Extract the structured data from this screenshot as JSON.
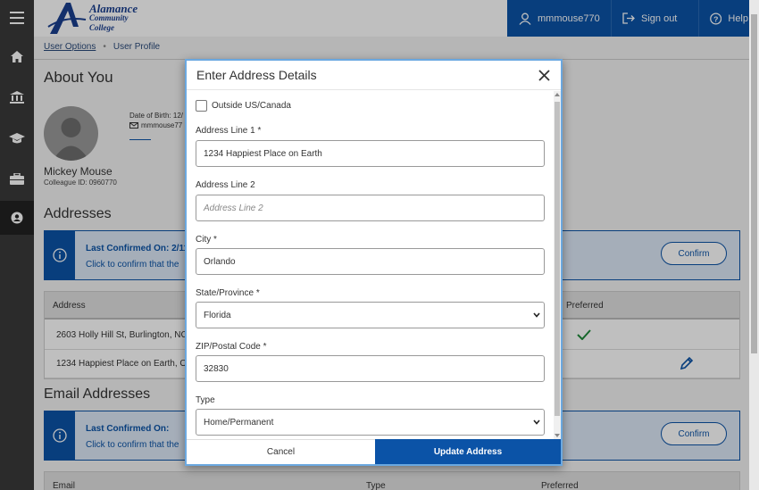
{
  "header": {
    "logo": {
      "line1": "Alamance",
      "line2": "Community College"
    },
    "user_label": "mmmouse770",
    "signout_label": "Sign out",
    "help_label": "Help"
  },
  "breadcrumb": {
    "link": "User Options",
    "current": "User Profile"
  },
  "profile": {
    "heading": "About You",
    "dob_text": "Date of Birth: 12/",
    "email_text": "mmmouse77",
    "name": "Mickey Mouse",
    "colleague_id": "Colleague ID: 0960770"
  },
  "addresses": {
    "heading": "Addresses",
    "confirm_title": "Last Confirmed On: 2/11",
    "confirm_text": "Click to confirm that the",
    "confirm_button": "Confirm",
    "columns": {
      "address": "Address",
      "preferred": "Preferred"
    },
    "rows": [
      {
        "address": "2603 Holly Hill St, Burlington, NC ..."
      },
      {
        "address": "1234 Happiest Place on Earth, Orl"
      }
    ]
  },
  "email_addresses": {
    "heading": "Email Addresses",
    "confirm_title": "Last Confirmed On:",
    "confirm_text": "Click to confirm that the",
    "confirm_button": "Confirm",
    "columns": {
      "email": "Email",
      "type": "Type",
      "preferred": "Preferred"
    }
  },
  "modal": {
    "title": "Enter Address Details",
    "outside_label": "Outside US/Canada",
    "address1_label": "Address Line 1 *",
    "address1_value": "1234 Happiest Place on Earth",
    "address2_label": "Address Line 2",
    "address2_placeholder": "Address Line 2",
    "city_label": "City *",
    "city_value": "Orlando",
    "state_label": "State/Province *",
    "state_value": "Florida",
    "zip_label": "ZIP/Postal Code *",
    "zip_value": "32830",
    "type_label": "Type",
    "type_value": "Home/Permanent",
    "cancel_label": "Cancel",
    "update_label": "Update Address"
  },
  "colors": {
    "brand_blue": "#0b53a7",
    "check_green": "#1e8a3a"
  }
}
